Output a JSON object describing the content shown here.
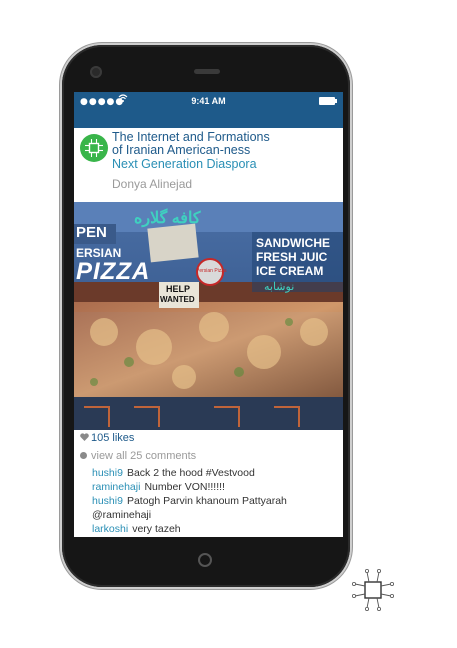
{
  "status_bar": {
    "signal": "●●●●●",
    "time": "9:41 AM"
  },
  "post_header": {
    "title_line1": "The Internet and Formations",
    "title_line2": "of Iranian American-ness",
    "subtitle": "Next Generation Diaspora",
    "author": "Donya Alinejad"
  },
  "photo": {
    "sign_open": "PEN",
    "sign_persian": "ERSIAN",
    "sign_pizza": "PIZZA",
    "sign_help": "HELP",
    "sign_wanted": "WANTED",
    "sign_right1": "SANDWICHE",
    "sign_right2": "FRESH JUIC",
    "sign_right3": "ICE CREAM",
    "sign_logo": "Persian Pizza",
    "sign_arabic": "کافه گلاره",
    "sign_arabic2": "نوشابه",
    "accent": "#1e5a8a"
  },
  "feed": {
    "likes": "105 likes",
    "view_comments": "view all 25 comments",
    "comments": [
      {
        "user": "hushi9",
        "text": "Back 2 the hood #Vestvood"
      },
      {
        "user": "raminehaji",
        "text": "Number VON!!!!!!"
      },
      {
        "user": "hushi9",
        "text": "Patogh Parvin khanoum Pattyarah"
      },
      {
        "user": "",
        "text": "@raminehaji"
      },
      {
        "user": "larkoshi",
        "text": "very tazeh"
      }
    ]
  },
  "colors": {
    "brand_blue": "#1e5a8a",
    "link_blue": "#2a8fb5",
    "logo_green": "#39b54a"
  }
}
